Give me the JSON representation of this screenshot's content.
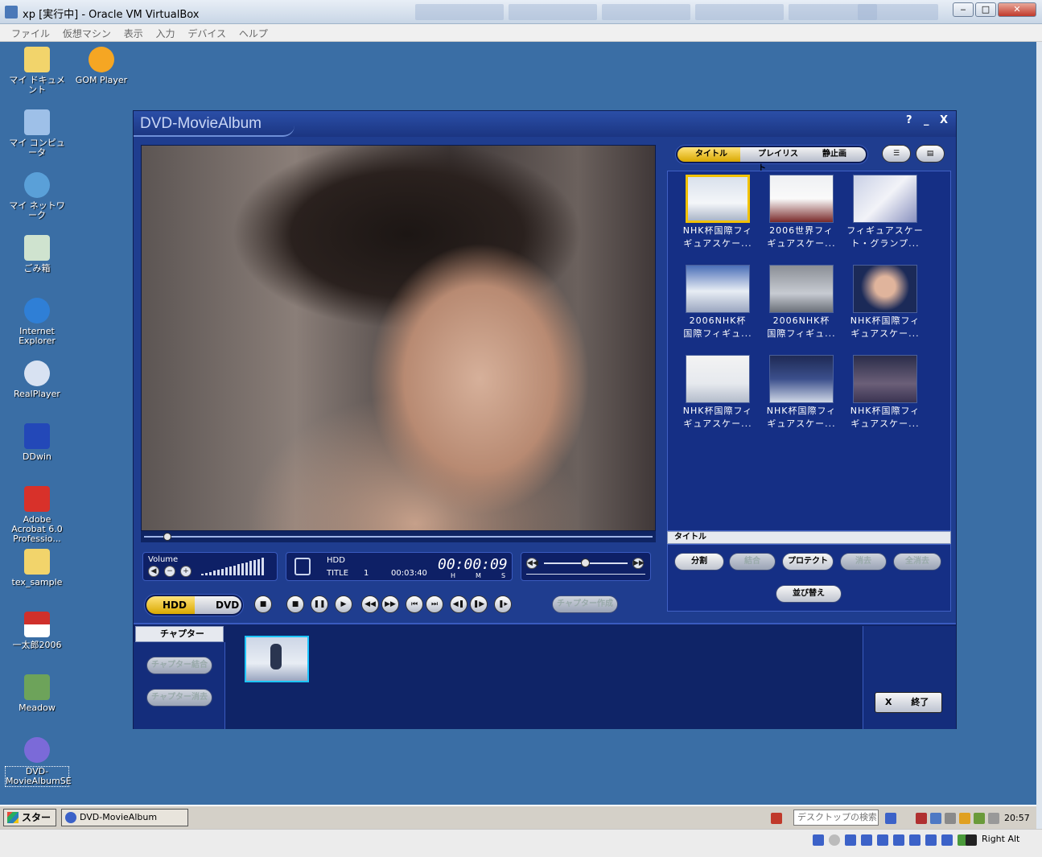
{
  "vbox": {
    "title": "xp [実行中] - Oracle VM VirtualBox",
    "menu": [
      "ファイル",
      "仮想マシン",
      "表示",
      "入力",
      "デバイス",
      "ヘルプ"
    ],
    "host_key": "Right Alt"
  },
  "desktop": {
    "icons": [
      {
        "label": "マイ ドキュメント",
        "icon": "folder-documents-icon"
      },
      {
        "label": "GOM Player",
        "icon": "gom-player-icon"
      },
      {
        "label": "マイ コンピュータ",
        "icon": "computer-icon"
      },
      {
        "label": "マイ ネットワーク",
        "icon": "network-icon"
      },
      {
        "label": "ごみ箱",
        "icon": "recycle-bin-icon"
      },
      {
        "label": "Internet Explorer",
        "icon": "internet-explorer-icon"
      },
      {
        "label": "RealPlayer",
        "icon": "realplayer-icon"
      },
      {
        "label": "DDwin",
        "icon": "dictionary-icon"
      },
      {
        "label": "Adobe Acrobat 6.0 Professio...",
        "icon": "acrobat-icon"
      },
      {
        "label": "tex_sample",
        "icon": "folder-icon"
      },
      {
        "label": "一太郎2006",
        "icon": "ichitaro-icon"
      },
      {
        "label": "Meadow",
        "icon": "meadow-icon"
      },
      {
        "label": "DVD-MovieAlbumSE",
        "icon": "dvd-moviealbum-icon"
      }
    ]
  },
  "app": {
    "title": "DVD-MovieAlbum",
    "controls": {
      "help": "?",
      "minimize": "_",
      "close": "X"
    },
    "volume_label": "Volume",
    "lcd": {
      "source": "HDD",
      "title_label": "TITLE",
      "title_no": "1",
      "duration": "00:03:40",
      "time": "00:00:09",
      "h": "H",
      "m": "M",
      "s": "S"
    },
    "source_toggle": {
      "hdd": "HDD",
      "dvd": "DVD"
    },
    "chapter_create": "チャプター作成",
    "tabs": {
      "title": "タイトル",
      "playlist": "プレイリスト",
      "still": "静止画"
    },
    "thumbnails": [
      {
        "caption1": "NHK杯国際フィ",
        "caption2": "ギュアスケー..."
      },
      {
        "caption1": "2006世界フィ",
        "caption2": "ギュアスケー..."
      },
      {
        "caption1": "フィギュアスケー",
        "caption2": "ト・グランプ..."
      },
      {
        "caption1": "2006NHK杯",
        "caption2": "国際フィギュ..."
      },
      {
        "caption1": "2006NHK杯",
        "caption2": "国際フィギュ..."
      },
      {
        "caption1": "NHK杯国際フィ",
        "caption2": "ギュアスケー..."
      },
      {
        "caption1": "NHK杯国際フィ",
        "caption2": "ギュアスケー..."
      },
      {
        "caption1": "NHK杯国際フィ",
        "caption2": "ギュアスケー..."
      },
      {
        "caption1": "NHK杯国際フィ",
        "caption2": "ギュアスケー..."
      }
    ],
    "section_label": "タイトル",
    "ops": {
      "split": "分割",
      "join": "結合",
      "protect": "プロテクト",
      "delete": "消去",
      "delete_all": "全消去",
      "sort": "並び替え"
    },
    "chapter": {
      "header": "チャプター",
      "join": "チャプター結合",
      "delete": "チャプター消去"
    },
    "exit": {
      "x": "X",
      "label": "終了"
    }
  },
  "taskbar": {
    "start": "スタート",
    "task": "DVD-MovieAlbum",
    "search_placeholder": "デスクトップの検索",
    "clock": "20:57"
  }
}
